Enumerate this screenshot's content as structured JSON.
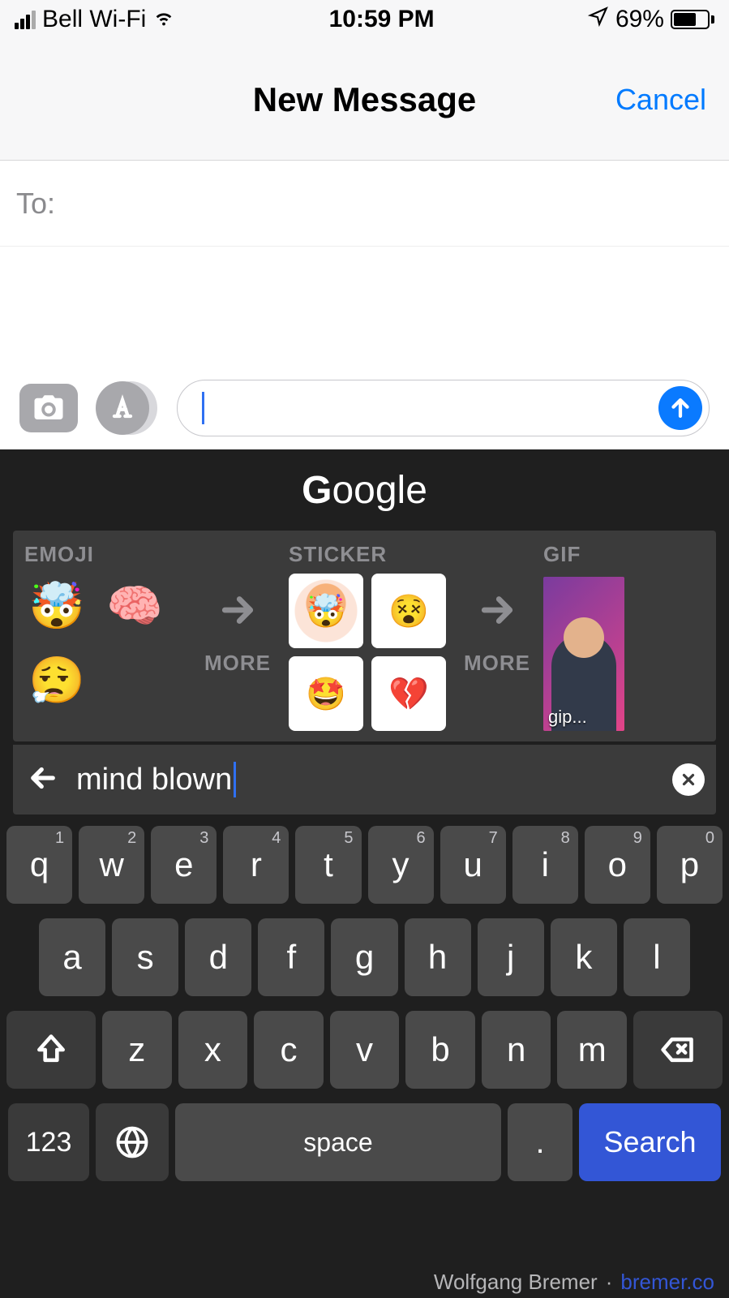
{
  "status": {
    "carrier": "Bell Wi-Fi",
    "time": "10:59 PM",
    "battery_pct": "69%"
  },
  "nav": {
    "title": "New Message",
    "cancel": "Cancel"
  },
  "compose": {
    "to_label": "To:"
  },
  "gboard": {
    "logo": "Google",
    "sections": {
      "emoji": "EMOJI",
      "sticker": "STICKER",
      "gif": "GIF",
      "more": "MORE"
    },
    "emoji_cells": [
      "🤯",
      "🧠",
      "😮‍💨"
    ],
    "sticker_cells": [
      "🤯",
      "😵",
      "🤩",
      "💔"
    ],
    "gif_caption": "gip...",
    "search_value": "mind blown"
  },
  "keyboard": {
    "row1": [
      {
        "k": "q",
        "n": "1"
      },
      {
        "k": "w",
        "n": "2"
      },
      {
        "k": "e",
        "n": "3"
      },
      {
        "k": "r",
        "n": "4"
      },
      {
        "k": "t",
        "n": "5"
      },
      {
        "k": "y",
        "n": "6"
      },
      {
        "k": "u",
        "n": "7"
      },
      {
        "k": "i",
        "n": "8"
      },
      {
        "k": "o",
        "n": "9"
      },
      {
        "k": "p",
        "n": "0"
      }
    ],
    "row2": [
      "a",
      "s",
      "d",
      "f",
      "g",
      "h",
      "j",
      "k",
      "l"
    ],
    "row3": [
      "z",
      "x",
      "c",
      "v",
      "b",
      "n",
      "m"
    ],
    "sym": "123",
    "space": "space",
    "period": ".",
    "search": "Search"
  },
  "watermark": {
    "author": "Wolfgang Bremer",
    "site": "bremer.co"
  }
}
